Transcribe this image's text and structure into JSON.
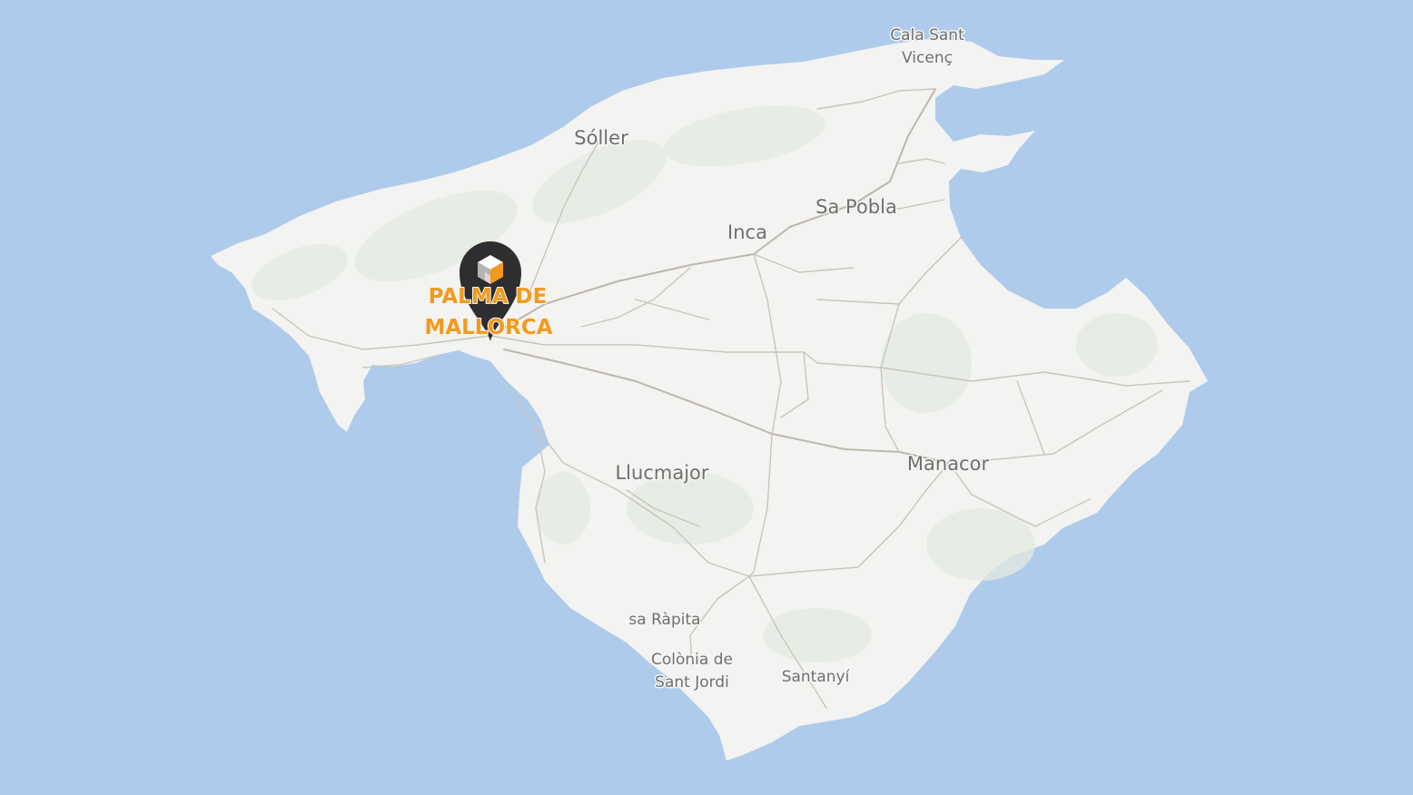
{
  "map": {
    "colors": {
      "sea": "#aecbeb",
      "land": "#f3f3f1",
      "vegetation": "#e3ebdf",
      "roads": "#c9c4bd",
      "label": "#6f6f6f",
      "accent": "#f39a1e",
      "marker": "#2e2e31"
    },
    "towns": {
      "cala_sant_vicenc_line1": "Cala Sant",
      "cala_sant_vicenc_line2": "Vicenç",
      "soller": "Sóller",
      "sa_pobla": "Sa Pobla",
      "inca": "Inca",
      "llucmajor": "Llucmajor",
      "manacor": "Manacor",
      "sa_rapita": "sa Ràpita",
      "colonia_line1": "Colònia de",
      "colonia_line2": "Sant Jordi",
      "santanyi": "Santanyí"
    },
    "marker": {
      "icon": "building-logo-icon",
      "label_line1": "PALMA DE",
      "label_line2": "MALLORCA"
    }
  }
}
